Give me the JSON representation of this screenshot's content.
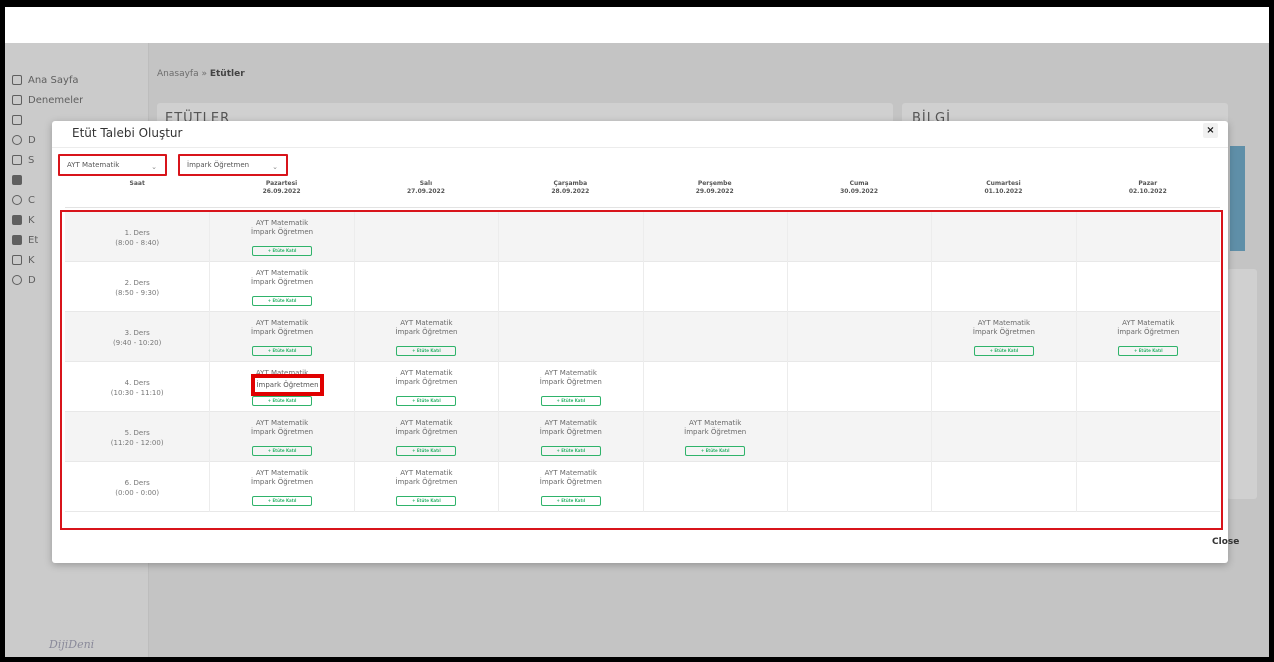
{
  "sidebar": {
    "items": [
      {
        "label": "Ana Sayfa",
        "icon": "home-icon"
      },
      {
        "label": "Denemeler",
        "icon": "list-icon"
      },
      {
        "label": "",
        "icon": "calendar-icon"
      },
      {
        "label": "D",
        "icon": "clock-icon"
      },
      {
        "label": "S",
        "icon": "checkbox-icon"
      },
      {
        "label": "",
        "icon": "database-icon"
      },
      {
        "label": "C",
        "icon": "bulb-icon"
      },
      {
        "label": "K",
        "icon": "book-icon"
      },
      {
        "label": "Et",
        "icon": "square-icon"
      },
      {
        "label": "K",
        "icon": "folder-icon"
      },
      {
        "label": "D",
        "icon": "globe-icon"
      }
    ],
    "logo": "DijiDeni"
  },
  "breadcrumb": {
    "home": "Anasayfa",
    "separator": "»",
    "current": "Etütler"
  },
  "panels": {
    "etutler_title": "ETÜTLER",
    "bilgi_title": "BİLGİ"
  },
  "modal": {
    "title": "Etüt Talebi Oluştur",
    "close_x": "×",
    "close_label": "Close",
    "subject_select": "AYT Matematik",
    "teacher_select": "İmpark Öğretmen",
    "join_label": "+ Etüte Katıl",
    "subject": "AYT Matematik",
    "teacher": "İmpark Öğretmen",
    "highlight_text": "İmpark Öğretmen",
    "header": {
      "saat": "Saat",
      "days": [
        {
          "day": "Pazartesi",
          "date": "26.09.2022"
        },
        {
          "day": "Salı",
          "date": "27.09.2022"
        },
        {
          "day": "Çarşamba",
          "date": "28.09.2022"
        },
        {
          "day": "Perşembe",
          "date": "29.09.2022"
        },
        {
          "day": "Cuma",
          "date": "30.09.2022"
        },
        {
          "day": "Cumartesi",
          "date": "01.10.2022"
        },
        {
          "day": "Pazar",
          "date": "02.10.2022"
        }
      ]
    },
    "rows": [
      {
        "ders": "1. Ders",
        "time": "(8:00 - 8:40)",
        "slots": [
          1,
          0,
          0,
          0,
          0,
          0,
          0
        ]
      },
      {
        "ders": "2. Ders",
        "time": "(8:50 - 9:30)",
        "slots": [
          1,
          0,
          0,
          0,
          0,
          0,
          0
        ]
      },
      {
        "ders": "3. Ders",
        "time": "(9:40 - 10:20)",
        "slots": [
          1,
          1,
          0,
          0,
          0,
          1,
          1
        ]
      },
      {
        "ders": "4. Ders",
        "time": "(10:30 - 11:10)",
        "slots": [
          1,
          1,
          1,
          0,
          0,
          0,
          0
        ]
      },
      {
        "ders": "5. Ders",
        "time": "(11:20 - 12:00)",
        "slots": [
          1,
          1,
          1,
          1,
          0,
          0,
          0
        ]
      },
      {
        "ders": "6. Ders",
        "time": "(0:00 - 0:00)",
        "slots": [
          1,
          1,
          1,
          0,
          0,
          0,
          0
        ]
      }
    ]
  },
  "colors": {
    "accent_red": "#d8141b",
    "join_green": "#2fb36a",
    "info_blue": "#5f8fa8"
  }
}
